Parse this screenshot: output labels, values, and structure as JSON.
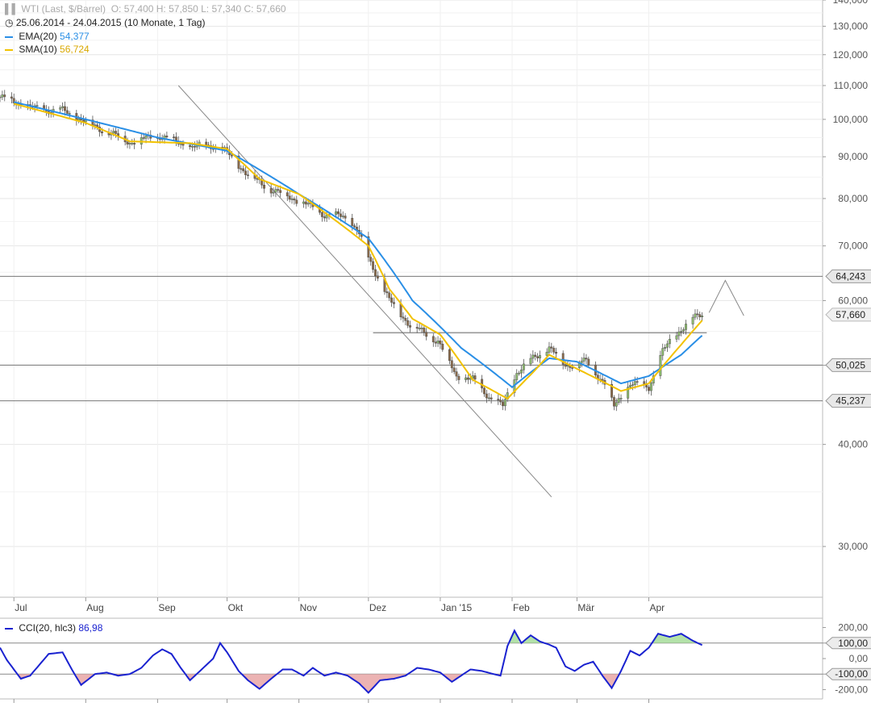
{
  "header": {
    "instrument": "WTI (Last, $/Barrel)",
    "ohlc": "O: 57,400  H: 57,850  L: 57,340  C: 57,660",
    "period": "25.06.2014 - 24.04.2015 (10 Monate, 1 Tag)",
    "ema_label": "EMA(20)",
    "ema_value": "54,377",
    "sma_label": "SMA(10)",
    "sma_value": "56,724",
    "cci_label": "CCI(20, hlc3)",
    "cci_value": "86,98"
  },
  "colors": {
    "up_candle": "#8fbf6f",
    "down_candle": "#8a6a4a",
    "ema": "#2a8fe6",
    "sma": "#f2c200",
    "cci": "#1a22d0",
    "cci_pos_fill": "#a6dd9a",
    "cci_neg_fill": "#e9a6a6",
    "grid": "#e6e6e6",
    "level_line": "#777777",
    "trend_line": "#888888"
  },
  "chart_data": [
    {
      "type": "candlestick",
      "scale": "log",
      "ylim": [
        26,
        140
      ],
      "y_ticks": [
        "140,000",
        "130,000",
        "120,000",
        "110,000",
        "100,000",
        "90,000",
        "80,000",
        "70,000",
        "60,000",
        "50,000",
        "40,000",
        "30,000"
      ],
      "y_tick_values": [
        140,
        130,
        120,
        110,
        100,
        90,
        80,
        70,
        60,
        50,
        40,
        30
      ],
      "x_tick_labels": [
        "Jul",
        "Aug",
        "Sep",
        "Okt",
        "Nov",
        "Dez",
        "Jan '15",
        "Feb",
        "Mär",
        "Apr"
      ],
      "x_tick_dates": [
        "2014-07-01",
        "2014-08-01",
        "2014-09-01",
        "2014-10-01",
        "2014-11-01",
        "2014-12-01",
        "2015-01-01",
        "2015-02-01",
        "2015-03-01",
        "2015-04-01"
      ],
      "x_range": [
        "2014-06-25",
        "2015-06-15"
      ],
      "close_anchors": [
        [
          "2014-06-25",
          106.5
        ],
        [
          "2014-07-10",
          103.0
        ],
        [
          "2014-07-22",
          102.5
        ],
        [
          "2014-08-05",
          98.0
        ],
        [
          "2014-08-20",
          93.8
        ],
        [
          "2014-09-02",
          95.5
        ],
        [
          "2014-09-15",
          92.5
        ],
        [
          "2014-09-25",
          93.0
        ],
        [
          "2014-10-01",
          91.0
        ],
        [
          "2014-10-10",
          85.5
        ],
        [
          "2014-10-20",
          82.0
        ],
        [
          "2014-11-01",
          79.5
        ],
        [
          "2014-11-12",
          76.5
        ],
        [
          "2014-11-20",
          76.0
        ],
        [
          "2014-11-26",
          73.5
        ],
        [
          "2014-12-01",
          67.5
        ],
        [
          "2014-12-10",
          60.0
        ],
        [
          "2014-12-19",
          56.0
        ],
        [
          "2014-12-31",
          53.5
        ],
        [
          "2015-01-08",
          48.5
        ],
        [
          "2015-01-15",
          48.0
        ],
        [
          "2015-01-23",
          45.5
        ],
        [
          "2015-01-28",
          44.5
        ],
        [
          "2015-02-03",
          49.0
        ],
        [
          "2015-02-10",
          51.0
        ],
        [
          "2015-02-17",
          52.5
        ],
        [
          "2015-02-24",
          50.0
        ],
        [
          "2015-03-05",
          50.5
        ],
        [
          "2015-03-13",
          47.5
        ],
        [
          "2015-03-17",
          44.5
        ],
        [
          "2015-03-24",
          47.5
        ],
        [
          "2015-04-01",
          47.0
        ],
        [
          "2015-04-07",
          52.0
        ],
        [
          "2015-04-15",
          55.5
        ],
        [
          "2015-04-20",
          57.0
        ],
        [
          "2015-04-24",
          57.66
        ]
      ],
      "series": [
        {
          "name": "EMA(20)",
          "anchors": [
            [
              "2014-07-01",
              105.0
            ],
            [
              "2014-08-01",
              100.0
            ],
            [
              "2014-09-01",
              95.0
            ],
            [
              "2014-10-01",
              91.5
            ],
            [
              "2014-11-01",
              81.0
            ],
            [
              "2014-12-01",
              71.5
            ],
            [
              "2014-12-20",
              60.0
            ],
            [
              "2015-01-10",
              52.5
            ],
            [
              "2015-02-01",
              47.0
            ],
            [
              "2015-02-17",
              51.0
            ],
            [
              "2015-03-01",
              50.5
            ],
            [
              "2015-03-20",
              47.5
            ],
            [
              "2015-04-01",
              48.5
            ],
            [
              "2015-04-15",
              51.5
            ],
            [
              "2015-04-24",
              54.377
            ]
          ]
        },
        {
          "name": "SMA(10)",
          "anchors": [
            [
              "2014-07-01",
              104.5
            ],
            [
              "2014-08-01",
              99.0
            ],
            [
              "2014-08-20",
              94.0
            ],
            [
              "2014-09-15",
              93.5
            ],
            [
              "2014-10-01",
              92.0
            ],
            [
              "2014-10-15",
              84.5
            ],
            [
              "2014-11-01",
              81.0
            ],
            [
              "2014-12-01",
              70.0
            ],
            [
              "2014-12-10",
              62.0
            ],
            [
              "2014-12-20",
              57.0
            ],
            [
              "2015-01-01",
              54.5
            ],
            [
              "2015-01-15",
              48.0
            ],
            [
              "2015-01-30",
              45.5
            ],
            [
              "2015-02-10",
              49.0
            ],
            [
              "2015-02-17",
              51.5
            ],
            [
              "2015-03-01",
              49.5
            ],
            [
              "2015-03-20",
              46.5
            ],
            [
              "2015-04-01",
              47.5
            ],
            [
              "2015-04-15",
              53.0
            ],
            [
              "2015-04-24",
              56.724
            ]
          ]
        }
      ],
      "horizontal_levels": [
        "64,243",
        "50,025",
        "45,237"
      ],
      "horizontal_level_values": [
        64.243,
        50.025,
        45.237
      ],
      "current_price": "57,660",
      "current_price_value": 57.66,
      "neckline": {
        "from": [
          "2014-12-03",
          54.8
        ],
        "to": [
          "2015-04-26",
          54.8
        ]
      },
      "trend_line": {
        "from": [
          "2014-09-10",
          110.0
        ],
        "to": [
          "2015-02-18",
          34.5
        ]
      },
      "projection": [
        [
          "2015-04-27",
          58.0
        ],
        [
          "2015-05-04",
          63.5
        ],
        [
          "2015-05-12",
          57.5
        ]
      ]
    },
    {
      "type": "line",
      "name": "CCI(20, hlc3)",
      "ylim": [
        -260,
        260
      ],
      "y_ticks": [
        "200,00",
        "100,00",
        "0,00",
        "-100,00",
        "-200,00"
      ],
      "y_tick_values": [
        200,
        100,
        0,
        -100,
        -200
      ],
      "boxed_ticks": [
        "100,00",
        "-100,00"
      ],
      "anchors": [
        [
          "2014-06-25",
          70
        ],
        [
          "2014-06-28",
          -10
        ],
        [
          "2014-07-04",
          -130
        ],
        [
          "2014-07-08",
          -110
        ],
        [
          "2014-07-12",
          -40
        ],
        [
          "2014-07-16",
          30
        ],
        [
          "2014-07-22",
          40
        ],
        [
          "2014-07-26",
          -70
        ],
        [
          "2014-07-30",
          -170
        ],
        [
          "2014-08-05",
          -100
        ],
        [
          "2014-08-10",
          -90
        ],
        [
          "2014-08-15",
          -110
        ],
        [
          "2014-08-20",
          -100
        ],
        [
          "2014-08-25",
          -60
        ],
        [
          "2014-08-30",
          20
        ],
        [
          "2014-09-03",
          60
        ],
        [
          "2014-09-07",
          30
        ],
        [
          "2014-09-11",
          -60
        ],
        [
          "2014-09-15",
          -140
        ],
        [
          "2014-09-20",
          -70
        ],
        [
          "2014-09-25",
          0
        ],
        [
          "2014-09-28",
          100
        ],
        [
          "2014-10-01",
          40
        ],
        [
          "2014-10-06",
          -80
        ],
        [
          "2014-10-10",
          -140
        ],
        [
          "2014-10-15",
          -195
        ],
        [
          "2014-10-20",
          -130
        ],
        [
          "2014-10-25",
          -70
        ],
        [
          "2014-10-29",
          -70
        ],
        [
          "2014-11-03",
          -110
        ],
        [
          "2014-11-07",
          -60
        ],
        [
          "2014-11-12",
          -110
        ],
        [
          "2014-11-17",
          -90
        ],
        [
          "2014-11-22",
          -110
        ],
        [
          "2014-11-27",
          -160
        ],
        [
          "2014-12-01",
          -220
        ],
        [
          "2014-12-06",
          -140
        ],
        [
          "2014-12-12",
          -130
        ],
        [
          "2014-12-17",
          -110
        ],
        [
          "2014-12-22",
          -60
        ],
        [
          "2014-12-27",
          -70
        ],
        [
          "2015-01-01",
          -90
        ],
        [
          "2015-01-06",
          -150
        ],
        [
          "2015-01-10",
          -110
        ],
        [
          "2015-01-14",
          -70
        ],
        [
          "2015-01-19",
          -80
        ],
        [
          "2015-01-24",
          -100
        ],
        [
          "2015-01-27",
          -110
        ],
        [
          "2015-01-30",
          80
        ],
        [
          "2015-02-02",
          180
        ],
        [
          "2015-02-05",
          100
        ],
        [
          "2015-02-09",
          150
        ],
        [
          "2015-02-13",
          110
        ],
        [
          "2015-02-17",
          90
        ],
        [
          "2015-02-20",
          70
        ],
        [
          "2015-02-24",
          -50
        ],
        [
          "2015-02-28",
          -80
        ],
        [
          "2015-03-04",
          -40
        ],
        [
          "2015-03-08",
          -20
        ],
        [
          "2015-03-12",
          -110
        ],
        [
          "2015-03-16",
          -190
        ],
        [
          "2015-03-20",
          -80
        ],
        [
          "2015-03-24",
          50
        ],
        [
          "2015-03-28",
          20
        ],
        [
          "2015-04-01",
          70
        ],
        [
          "2015-04-05",
          160
        ],
        [
          "2015-04-10",
          140
        ],
        [
          "2015-04-15",
          160
        ],
        [
          "2015-04-20",
          115
        ],
        [
          "2015-04-24",
          86.98
        ]
      ]
    }
  ]
}
